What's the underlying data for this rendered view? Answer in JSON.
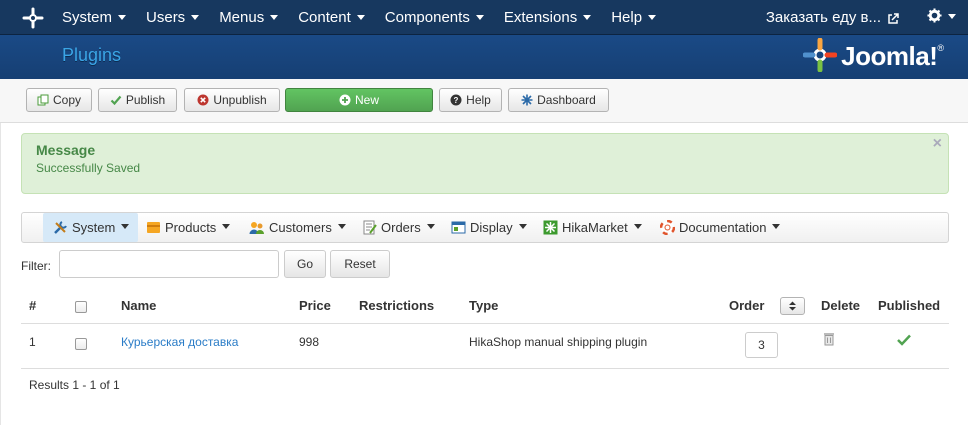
{
  "navbar": {
    "menu": [
      "System",
      "Users",
      "Menus",
      "Content",
      "Components",
      "Extensions",
      "Help"
    ],
    "site_name": "Заказать еду в...",
    "icons": [
      "joomla-icon",
      "external-link-icon",
      "gear-icon"
    ]
  },
  "header": {
    "title": "Plugins",
    "logo_text": "Joomla!",
    "logo_mark": "®"
  },
  "toolbar": {
    "copy": "Copy",
    "publish": "Publish",
    "unpublish": "Unpublish",
    "new": "New",
    "help": "Help",
    "dashboard": "Dashboard"
  },
  "message": {
    "heading": "Message",
    "text": "Successfully Saved",
    "close": "×"
  },
  "hika_menu": {
    "items": [
      "System",
      "Products",
      "Customers",
      "Orders",
      "Display",
      "HikaMarket",
      "Documentation"
    ],
    "active": "System"
  },
  "filter": {
    "label": "Filter:",
    "value": "",
    "go": "Go",
    "reset": "Reset"
  },
  "table": {
    "headers": [
      "#",
      "Name",
      "Price",
      "Restrictions",
      "Type",
      "Order",
      "Delete",
      "Published"
    ],
    "rows": [
      {
        "num": "1",
        "name": "Курьерская доставка",
        "price": "998",
        "restrictions": "",
        "type": "HikaShop manual shipping plugin",
        "order": "3",
        "published": true
      }
    ]
  },
  "results": "Results 1 - 1 of 1",
  "colors": {
    "navbar": "#17385f",
    "header": "#1a4a86",
    "title": "#3ba5e6",
    "success": "#51a351",
    "alert_bg": "#dff0d8",
    "alert_text": "#468847",
    "link": "#2a7cc7"
  }
}
